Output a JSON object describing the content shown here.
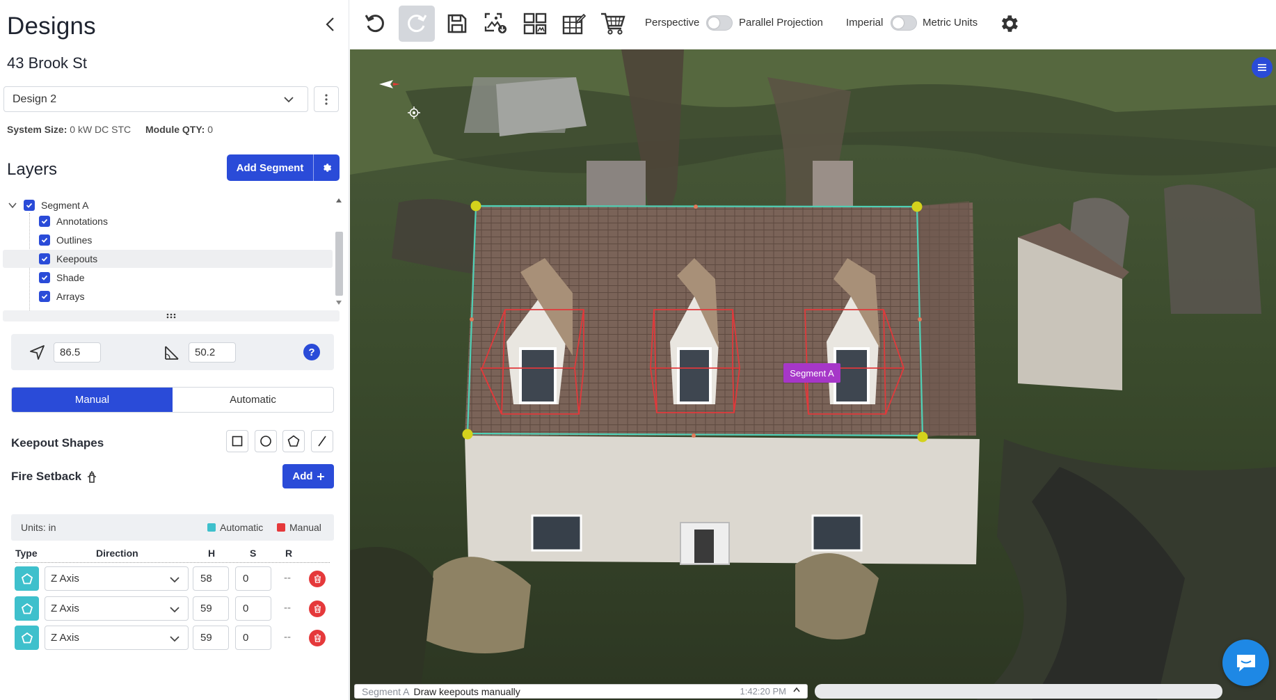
{
  "sidebar": {
    "title": "Designs",
    "address": "43 Brook St",
    "design_select": "Design 2",
    "system_size_label": "System Size:",
    "system_size_value": "0 kW DC STC",
    "module_qty_label": "Module QTY:",
    "module_qty_value": "0",
    "layers_title": "Layers",
    "add_segment_label": "Add Segment",
    "tree": {
      "root": "Segment A",
      "children": [
        "Annotations",
        "Outlines",
        "Keepouts",
        "Shade",
        "Arrays"
      ],
      "selected": "Keepouts"
    },
    "azimuth": "86.5",
    "pitch": "50.2",
    "help_label": "?",
    "mode": {
      "manual": "Manual",
      "automatic": "Automatic",
      "selected": "Manual"
    },
    "keepout_shapes_label": "Keepout Shapes",
    "keepout_shape_icons": [
      "square-icon",
      "circle-icon",
      "pentagon-icon",
      "line-icon"
    ],
    "fire_setback_label": "Fire Setback",
    "add_label": "Add",
    "units_label": "Units: in",
    "legend": [
      {
        "label": "Automatic",
        "color": "#3ec0cc"
      },
      {
        "label": "Manual",
        "color": "#e5393b"
      }
    ],
    "table": {
      "headers": {
        "type": "Type",
        "direction": "Direction",
        "h": "H",
        "s": "S",
        "r": "R"
      },
      "rows": [
        {
          "direction": "Z Axis",
          "h": "58",
          "s": "0",
          "r": "--"
        },
        {
          "direction": "Z Axis",
          "h": "59",
          "s": "0",
          "r": "--"
        },
        {
          "direction": "Z Axis",
          "h": "59",
          "s": "0",
          "r": "--"
        }
      ]
    }
  },
  "toolbar": {
    "buttons": [
      "undo-icon",
      "redo-icon",
      "save-icon",
      "export-image-icon",
      "layout-grid-icon",
      "edit-table-icon",
      "cart-icon"
    ],
    "perspective_label": "Perspective",
    "parallel_label": "Parallel Projection",
    "imperial_label": "Imperial",
    "metric_label": "Metric Units"
  },
  "viewport": {
    "segment_label": "Segment A",
    "status_segment": "Segment A",
    "status_message": "Draw keepouts manually",
    "status_time": "1:42:20 PM"
  },
  "colors": {
    "accent": "#2a4bd8",
    "automatic": "#3ec0cc",
    "manual": "#e5393b",
    "segment_label": "#a637c8",
    "outline": "#4fd1b6",
    "vertex": "#d4d21c"
  }
}
